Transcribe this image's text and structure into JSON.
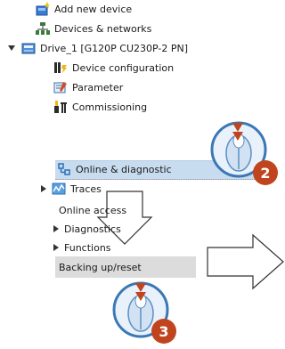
{
  "tree": {
    "items": [
      {
        "label": "Add new device",
        "icon": "add-device-icon"
      },
      {
        "label": "Devices & networks",
        "icon": "network-icon"
      },
      {
        "label": "Drive_1 [G120P CU230P-2 PN]",
        "icon": "drive-icon"
      },
      {
        "label": "Device configuration",
        "icon": "device-config-icon"
      },
      {
        "label": "Parameter",
        "icon": "parameter-icon"
      },
      {
        "label": "Commissioning",
        "icon": "commissioning-icon"
      },
      {
        "label": "Online & diagnostic",
        "icon": "diagnostics-icon"
      },
      {
        "label": "Traces",
        "icon": "traces-icon"
      }
    ]
  },
  "menu": {
    "items": [
      {
        "label": "Online access"
      },
      {
        "label": "Diagnostics"
      },
      {
        "label": "Functions"
      },
      {
        "label": "Backing up/reset"
      }
    ]
  },
  "steps": {
    "two": "2",
    "three": "3"
  },
  "colors": {
    "selection": "#c8dcef",
    "badge": "#c0451e",
    "cursor_arrow": "#c0451e",
    "menu_highlight": "#dcdcdc"
  }
}
